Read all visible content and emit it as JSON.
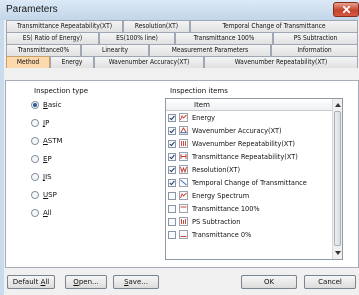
{
  "window": {
    "title": "Parameters",
    "close_icon": "close-icon"
  },
  "tabs": {
    "row1": [
      "Transmittance Repeatability(XT)",
      "Resolution(XT)",
      "Temporal Change of Transmittance"
    ],
    "row2": [
      "ES( Ratio of Energy)",
      "ES(100% line)",
      "Transmittance 100%",
      "PS Subtraction"
    ],
    "row3": [
      "Transmittance0%",
      "Linearity",
      "Measurement Parameters",
      "Information"
    ],
    "row4": [
      "Method",
      "Energy",
      "Wavenumber Accuracy(XT)",
      "Wavenumber Repeatability(XT)"
    ],
    "active": "Method"
  },
  "inspection_type": {
    "label": "Inspection type",
    "options": [
      {
        "key": "B",
        "rest": "asic",
        "selected": true
      },
      {
        "key": "J",
        "rest": "P",
        "selected": false
      },
      {
        "key": "A",
        "rest": "STM",
        "selected": false
      },
      {
        "key": "E",
        "rest": "P",
        "selected": false
      },
      {
        "key": "J",
        "rest": "IS",
        "selected": false
      },
      {
        "key": "U",
        "rest": "SP",
        "selected": false
      },
      {
        "key": "A",
        "rest": "ll",
        "selected": false
      }
    ]
  },
  "inspection_items": {
    "label": "Inspection items",
    "column_header": "Item",
    "items": [
      {
        "label": "Energy",
        "checked": true,
        "icon": "energy-chart-icon"
      },
      {
        "label": "Wavenumber Accuracy(XT)",
        "checked": true,
        "icon": "wavenumber-accuracy-icon"
      },
      {
        "label": "Wavenumber Repeatability(XT)",
        "checked": true,
        "icon": "wavenumber-repeatability-icon"
      },
      {
        "label": "Transmittance Repeatability(XT)",
        "checked": true,
        "icon": "transmittance-repeatability-icon"
      },
      {
        "label": "Resolution(XT)",
        "checked": true,
        "icon": "resolution-icon"
      },
      {
        "label": "Temporal Change of Transmittance",
        "checked": true,
        "icon": "temporal-change-icon"
      },
      {
        "label": "Energy Spectrum",
        "checked": false,
        "icon": "energy-spectrum-icon"
      },
      {
        "label": "Transmittance 100%",
        "checked": false,
        "icon": "transmittance-100-icon"
      },
      {
        "label": "PS Subtraction",
        "checked": false,
        "icon": "ps-subtraction-icon"
      },
      {
        "label": "Transmittance 0%",
        "checked": false,
        "icon": "transmittance-0-icon"
      }
    ]
  },
  "buttons": {
    "default_all": {
      "key": "A",
      "pre": "Default ",
      "post": "ll"
    },
    "open": {
      "key": "O",
      "pre": "",
      "post": "pen..."
    },
    "save": {
      "key": "S",
      "pre": "",
      "post": "ave..."
    },
    "ok": "OK",
    "cancel": "Cancel"
  },
  "colors": {
    "active_tab": "#fdd9ae",
    "titlebar": "#c9dced",
    "close_button": "#c4452e"
  }
}
